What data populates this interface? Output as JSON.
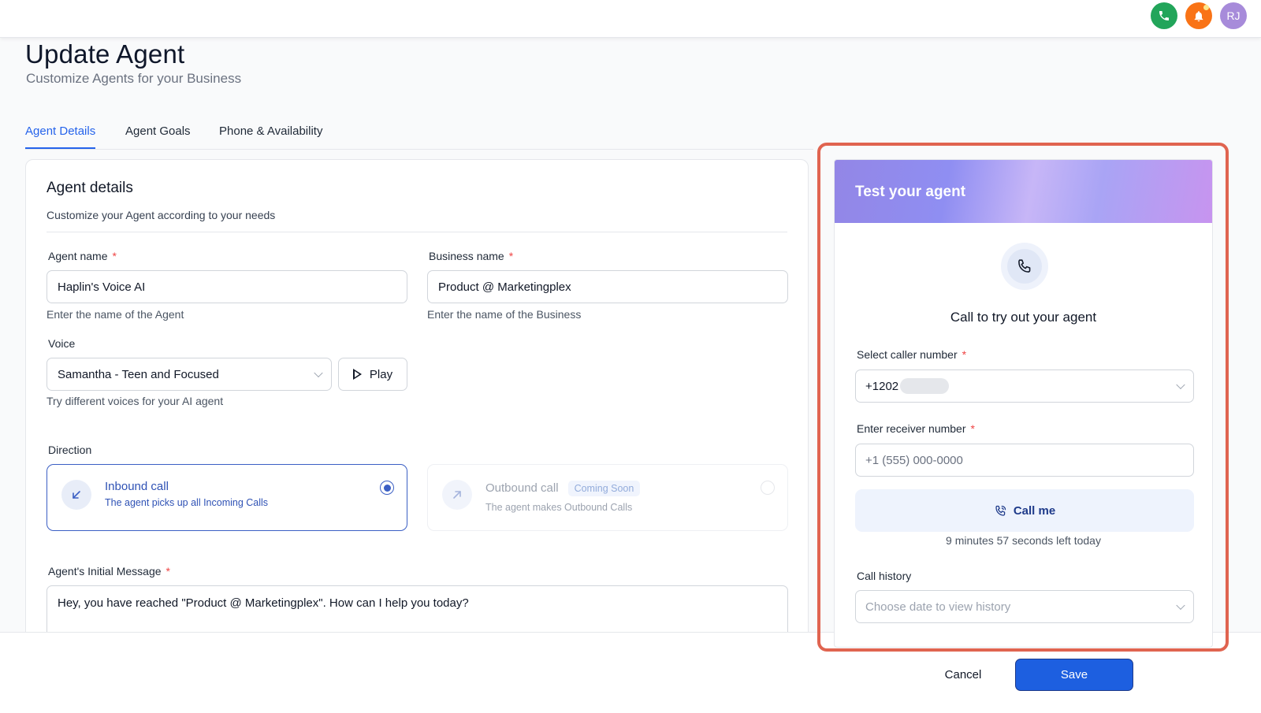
{
  "header": {
    "title": "Update Agent",
    "subtitle": "Customize Agents for your Business",
    "avatar_initials": "RJ"
  },
  "tabs": [
    {
      "label": "Agent Details",
      "active": true
    },
    {
      "label": "Agent Goals",
      "active": false
    },
    {
      "label": "Phone & Availability",
      "active": false
    }
  ],
  "agent_details": {
    "title": "Agent details",
    "subtitle": "Customize your Agent according to your needs",
    "agent_name": {
      "label": "Agent name",
      "required_mark": "*",
      "value": "Haplin's Voice AI",
      "hint": "Enter the name of the Agent"
    },
    "business_name": {
      "label": "Business name",
      "required_mark": "*",
      "value": "Product @ Marketingplex",
      "hint": "Enter the name of the Business"
    },
    "voice": {
      "label": "Voice",
      "selected": "Samantha - Teen and Focused",
      "play_label": "Play",
      "hint": "Try different voices for your AI agent"
    },
    "direction": {
      "label": "Direction",
      "inbound": {
        "title": "Inbound call",
        "description": "The agent picks up all Incoming Calls",
        "selected": true
      },
      "outbound": {
        "title": "Outbound call",
        "badge": "Coming Soon",
        "description": "The agent makes Outbound Calls",
        "selected": false
      }
    },
    "initial_message": {
      "label": "Agent's Initial Message",
      "required_mark": "*",
      "value": "Hey, you have reached \"Product @ Marketingplex\". How can I help you today?"
    }
  },
  "test_panel": {
    "title": "Test your agent",
    "call_prompt": "Call to try out your agent",
    "caller_number": {
      "label": "Select caller number",
      "required_mark": "*",
      "value": "+1202"
    },
    "receiver_number": {
      "label": "Enter receiver number",
      "required_mark": "*",
      "placeholder": "+1 (555) 000-0000"
    },
    "call_button": "Call me",
    "time_left": "9 minutes 57 seconds left today",
    "call_history": {
      "label": "Call history",
      "placeholder": "Choose date to view history"
    }
  },
  "footer": {
    "cancel_label": "Cancel",
    "save_label": "Save"
  },
  "colors": {
    "accent": "#2563eb",
    "save_button": "#1d5fe0",
    "highlight_border": "#e06450",
    "required": "#ef4444",
    "phone_icon_bg": "#22a55a",
    "bell_icon_bg": "#f97316",
    "avatar_bg": "#a78bda"
  },
  "icons": {
    "top_phone": "phone-icon",
    "top_bell": "bell-icon",
    "voice_play": "play-icon",
    "inbound": "arrow-down-left-icon",
    "outbound": "arrow-up-right-icon",
    "test_phone": "phone-icon",
    "call_me": "phone-ringing-icon"
  }
}
